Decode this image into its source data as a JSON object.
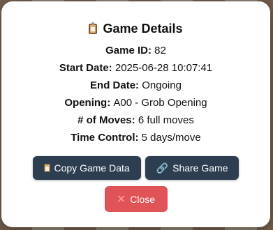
{
  "dialog": {
    "title": "Game Details",
    "title_icon": "clipboard-icon",
    "fields": [
      {
        "label": "Game ID:",
        "value": "82"
      },
      {
        "label": "Start Date:",
        "value": "2025-06-28 10:07:41"
      },
      {
        "label": "End Date:",
        "value": "Ongoing"
      },
      {
        "label": "Opening:",
        "value": "A00 - Grob Opening"
      },
      {
        "label": "# of Moves:",
        "value": "6 full moves"
      },
      {
        "label": "Time Control:",
        "value": "5 days/move"
      }
    ],
    "buttons": {
      "copy_label": "Copy Game Data",
      "share_label": "Share Game",
      "close_label": "Close"
    }
  },
  "colors": {
    "button_dark": "#2c3e50",
    "button_close": "#e05356",
    "modal_bg": "#ffffff"
  }
}
